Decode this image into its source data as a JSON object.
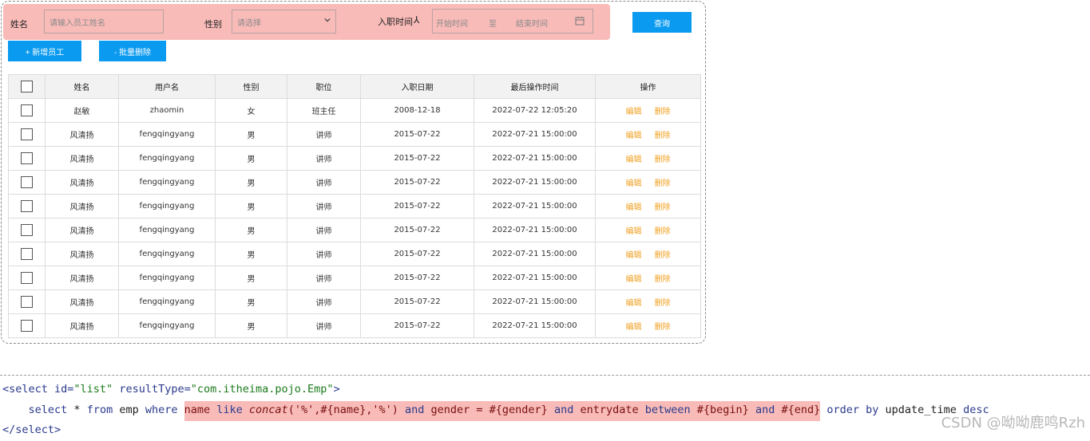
{
  "search": {
    "name_label": "姓名",
    "name_placeholder": "请输入员工姓名",
    "gender_label": "性别",
    "gender_placeholder": "请选择",
    "entry_label": "入职时间",
    "start_placeholder": "开始时间",
    "range_sep": "至",
    "end_placeholder": "结束时间",
    "query_button": "查询"
  },
  "toolbar": {
    "add_button": "+ 新增员工",
    "batch_delete_button": "- 批量删除"
  },
  "table": {
    "headers": [
      "姓名",
      "用户名",
      "性别",
      "职位",
      "入职日期",
      "最后操作时间",
      "操作"
    ],
    "edit_label": "编辑",
    "delete_label": "删除",
    "rows": [
      {
        "name": "赵敏",
        "username": "zhaomin",
        "gender": "女",
        "job": "班主任",
        "entry": "2008-12-18",
        "updated": "2022-07-22 12:05:20"
      },
      {
        "name": "风清扬",
        "username": "fengqingyang",
        "gender": "男",
        "job": "讲师",
        "entry": "2015-07-22",
        "updated": "2022-07-21 15:00:00"
      },
      {
        "name": "风清扬",
        "username": "fengqingyang",
        "gender": "男",
        "job": "讲师",
        "entry": "2015-07-22",
        "updated": "2022-07-21 15:00:00"
      },
      {
        "name": "风清扬",
        "username": "fengqingyang",
        "gender": "男",
        "job": "讲师",
        "entry": "2015-07-22",
        "updated": "2022-07-21 15:00:00"
      },
      {
        "name": "风清扬",
        "username": "fengqingyang",
        "gender": "男",
        "job": "讲师",
        "entry": "2015-07-22",
        "updated": "2022-07-21 15:00:00"
      },
      {
        "name": "风清扬",
        "username": "fengqingyang",
        "gender": "男",
        "job": "讲师",
        "entry": "2015-07-22",
        "updated": "2022-07-21 15:00:00"
      },
      {
        "name": "风清扬",
        "username": "fengqingyang",
        "gender": "男",
        "job": "讲师",
        "entry": "2015-07-22",
        "updated": "2022-07-21 15:00:00"
      },
      {
        "name": "风清扬",
        "username": "fengqingyang",
        "gender": "男",
        "job": "讲师",
        "entry": "2015-07-22",
        "updated": "2022-07-21 15:00:00"
      },
      {
        "name": "风清扬",
        "username": "fengqingyang",
        "gender": "男",
        "job": "讲师",
        "entry": "2015-07-22",
        "updated": "2022-07-21 15:00:00"
      },
      {
        "name": "风清扬",
        "username": "fengqingyang",
        "gender": "男",
        "job": "讲师",
        "entry": "2015-07-22",
        "updated": "2022-07-21 15:00:00"
      }
    ]
  },
  "code": {
    "line1_open": "<select",
    "line1_id_attr": " id=",
    "line1_id_val": "\"list\"",
    "line1_rt_attr": " resultType=",
    "line1_rt_val": "\"com.itheima.pojo.Emp\"",
    "line1_close": ">",
    "line2_indent": "    ",
    "line2_select": "select",
    "line2_star": " * ",
    "line2_from": "from",
    "line2_emp": " emp ",
    "line2_where": "where",
    "hl_name": "name ",
    "hl_like": "like ",
    "hl_concat": "concat",
    "hl_args": "('%',#{name},'%') ",
    "hl_and1": "and ",
    "hl_gender": "gender = #{gender} ",
    "hl_and2": "and ",
    "hl_entry": "entrydate ",
    "hl_between": "between ",
    "hl_begin": "#{begin} ",
    "hl_and3": "and ",
    "hl_end": "#{end}",
    "line2_order": " order by ",
    "line2_update": "update_time ",
    "line2_desc": "desc",
    "line3": "</select>"
  },
  "watermark": "CSDN @呦呦鹿鸣Rzh",
  "colors": {
    "highlight": "#f8bbb8",
    "primary_button": "#0a9af0",
    "operation_link": "#f0a020"
  }
}
